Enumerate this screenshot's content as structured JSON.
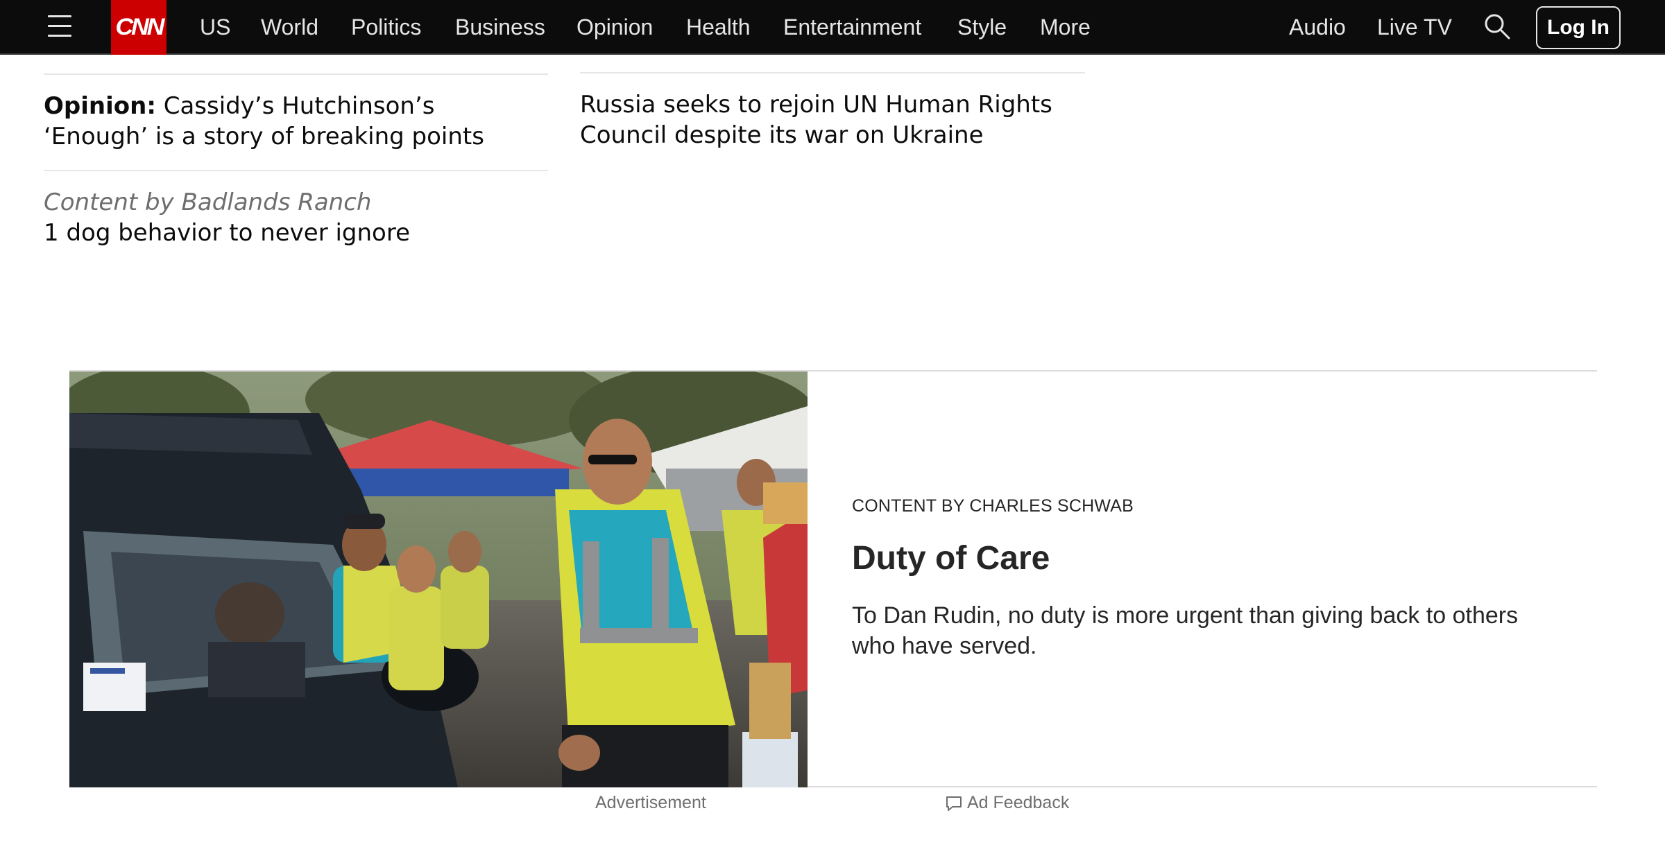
{
  "nav": {
    "logo": "CNN",
    "items": [
      "US",
      "World",
      "Politics",
      "Business",
      "Opinion",
      "Health",
      "Entertainment",
      "Style",
      "More"
    ],
    "right_items": [
      "Audio",
      "Live TV"
    ],
    "login_label": "Log In",
    "icons": {
      "menu": "hamburger-menu-icon",
      "search": "search-icon"
    },
    "colors": {
      "bar": "#0c0c0c",
      "logo_bg": "#cc0000",
      "text": "#e6e6e6"
    }
  },
  "headlines": {
    "left": [
      {
        "prefix": "Opinion:",
        "text": "Cassidy’s Hutchinson’s ‘Enough’ is a story of breaking points"
      },
      {
        "sponsor": "Content by Badlands Ranch",
        "text": "1 dog behavior to never ignore"
      }
    ],
    "right": [
      {
        "text": "Russia seeks to rejoin UN Human Rights Council despite its war on Ukraine"
      }
    ]
  },
  "ad": {
    "kicker": "CONTENT BY CHARLES SCHWAB",
    "title": "Duty of Care",
    "description": "To Dan Rudin, no duty is more urgent than giving back to others who have served.",
    "image_alt": "Volunteers in yellow safety vests handing out supplies to drivers at a car line"
  },
  "footer": {
    "advertisement_label": "Advertisement",
    "feedback_label": "Ad Feedback",
    "feedback_icon": "speech-bubble-icon"
  }
}
